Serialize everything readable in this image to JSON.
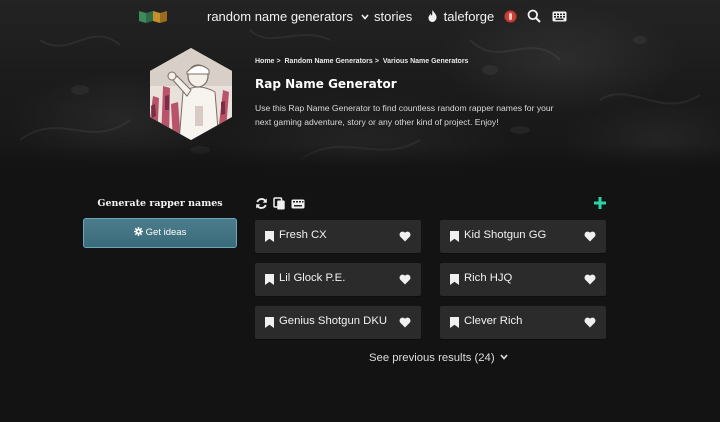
{
  "nav": {
    "generators_label": "random name generators",
    "stories_label": "stories",
    "taleforge_label": "taleforge"
  },
  "hero": {
    "breadcrumb": [
      "Home",
      "Random Name Generators",
      "Various Name Generators"
    ],
    "breadcrumb_separator": ">",
    "title": "Rap Name Generator",
    "description": "Use this Rap Name Generator to find countless random rapper names for your next gaming adventure, story or any other kind of project. Enjoy!"
  },
  "sidebar": {
    "heading": "Generate rapper names",
    "get_ideas_label": "Get ideas"
  },
  "results": {
    "names": [
      "Fresh CX",
      "Kid Shotgun GG",
      "Lil Glock P.E.",
      "Rich HJQ",
      "Genius Shotgun DKU",
      "Clever Rich"
    ],
    "previous_label": "See previous results (24)"
  },
  "colors": {
    "accent_teal": "#2bd4a8",
    "button_blue": "#3f6f7e",
    "card_bg": "#2b2b2b",
    "page_bg": "#131313",
    "avatar_red": "#c9413a"
  },
  "icons": {
    "nav": [
      "logo-icon",
      "chevron-down-icon",
      "flame-icon",
      "avatar-icon",
      "search-icon",
      "keyboard-icon"
    ],
    "toolbar": [
      "refresh-icon",
      "copy-icon",
      "keyboard-icon",
      "plus-icon"
    ],
    "card": [
      "bookmark-icon",
      "heart-icon"
    ],
    "button": [
      "gear-icon"
    ]
  }
}
